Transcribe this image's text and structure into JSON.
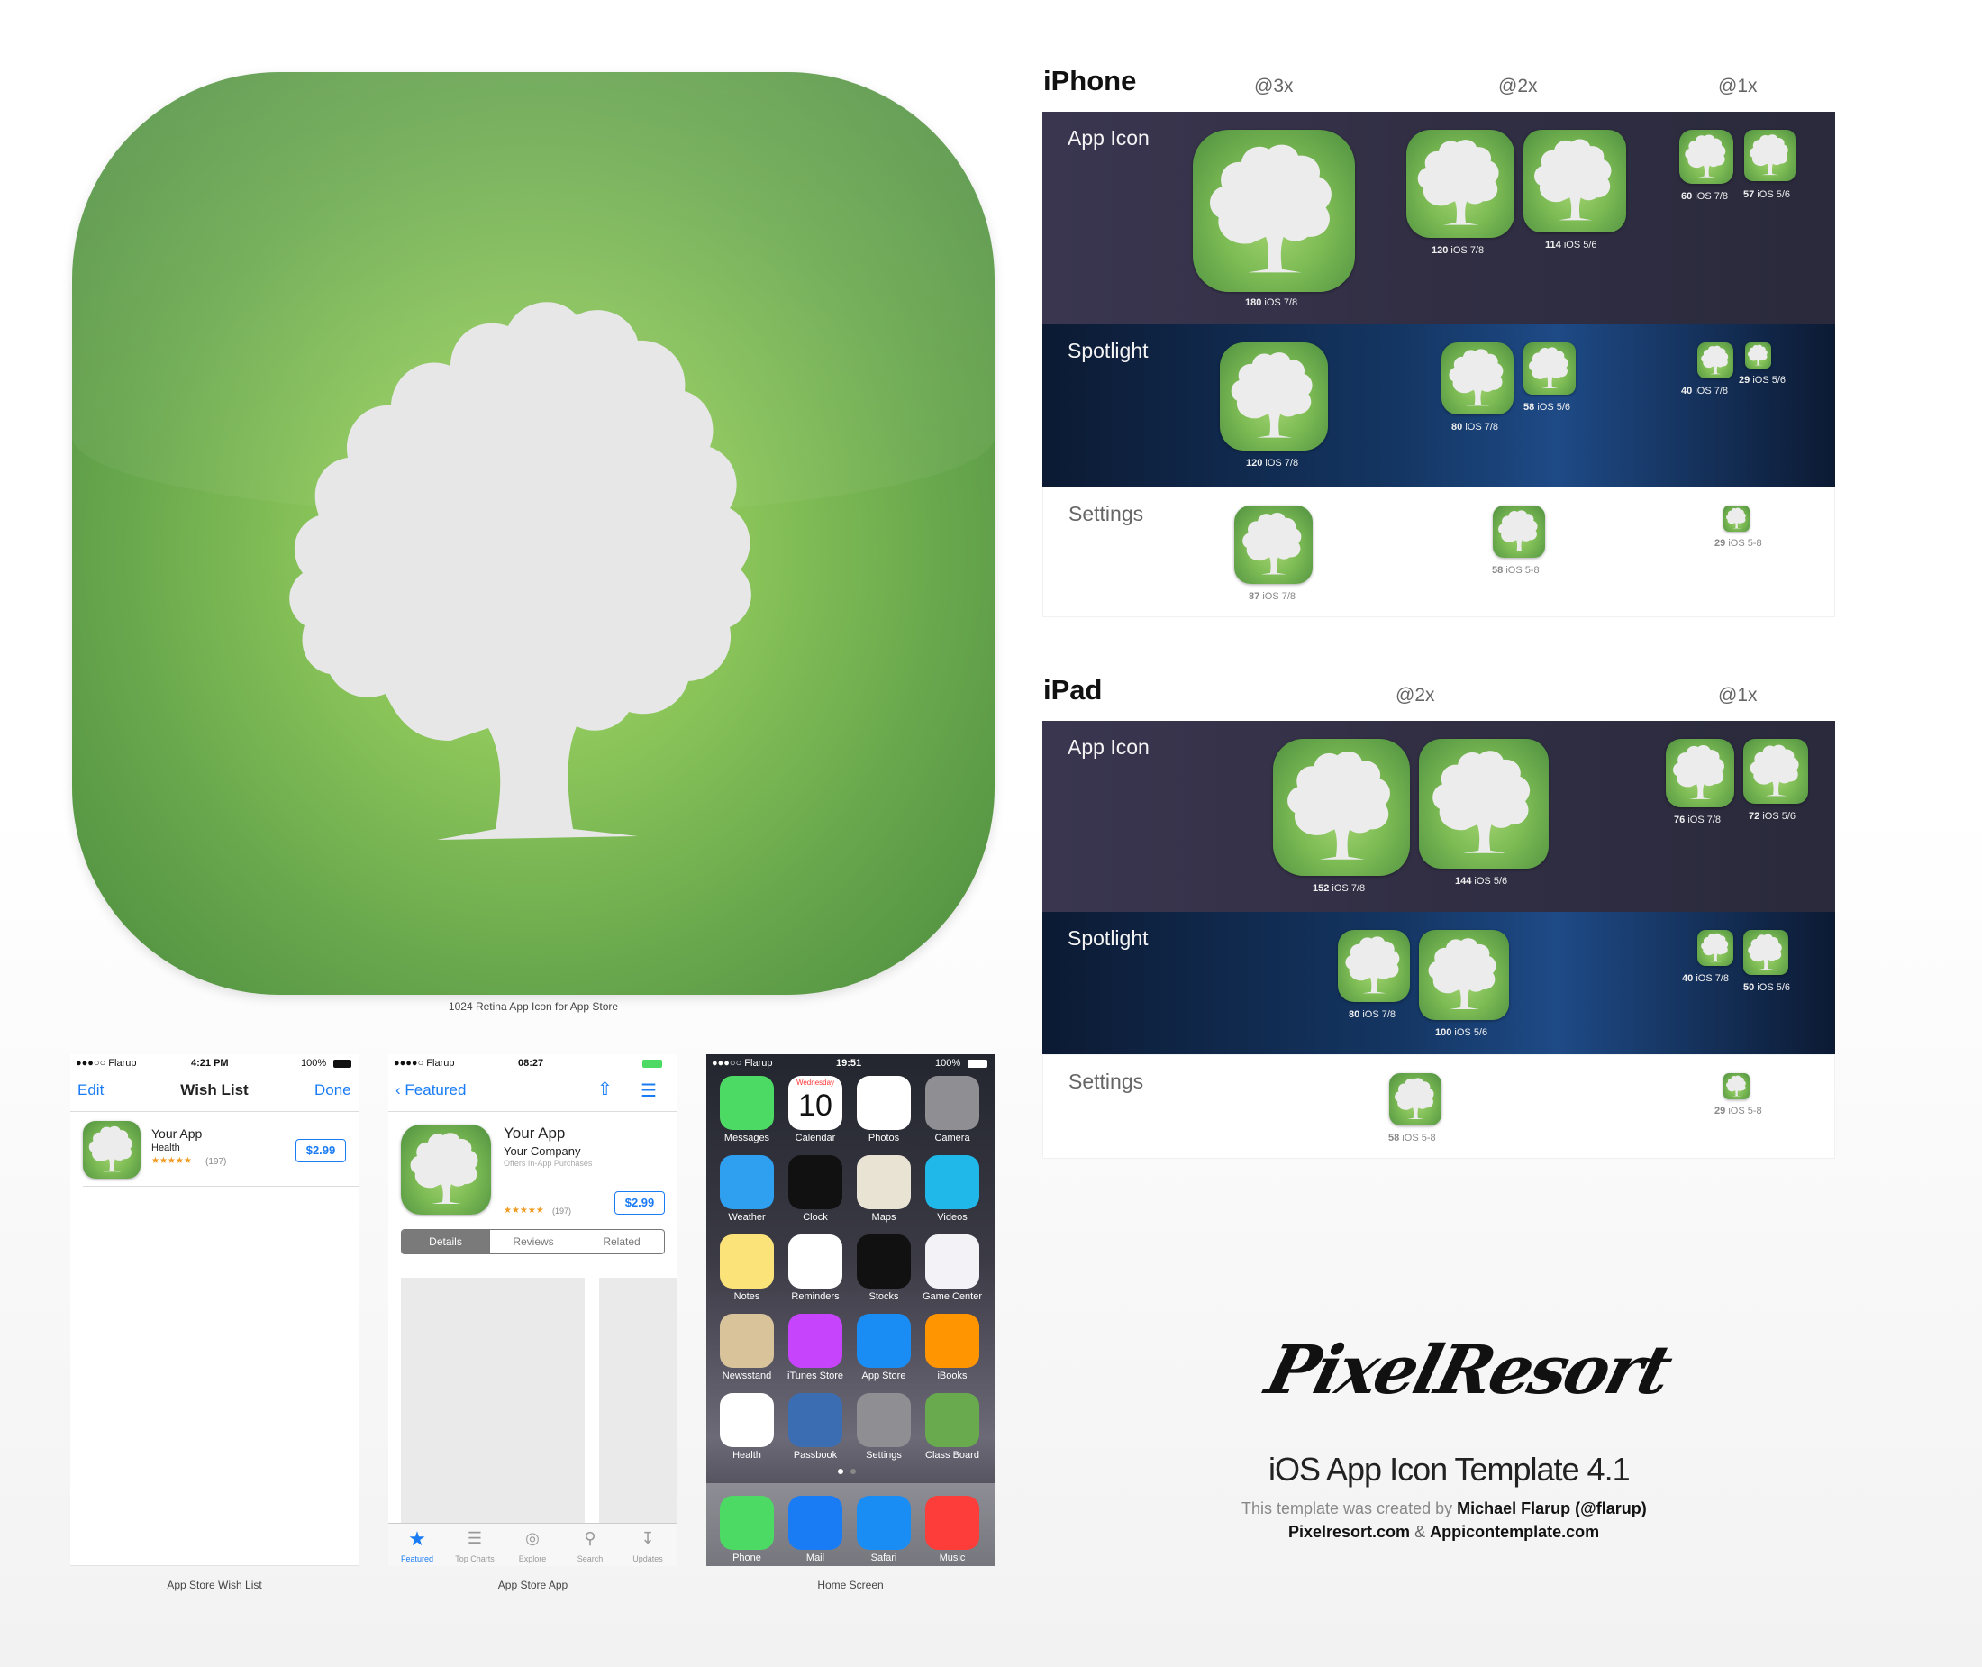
{
  "big_icon": {
    "caption": "1024 Retina App Icon for App Store"
  },
  "iphone": {
    "title": "iPhone",
    "scales": [
      "@3x",
      "@2x",
      "@1x"
    ],
    "rows": {
      "app_icon": "App Icon",
      "spotlight": "Spotlight",
      "settings": "Settings"
    },
    "labels": [
      {
        "size": "180",
        "os": "iOS 7/8"
      },
      {
        "size": "120",
        "os": "iOS 7/8"
      },
      {
        "size": "114",
        "os": "iOS 5/6"
      },
      {
        "size": "60",
        "os": "iOS 7/8"
      },
      {
        "size": "57",
        "os": "iOS 5/6"
      },
      {
        "size": "120",
        "os": "iOS 7/8"
      },
      {
        "size": "80",
        "os": "iOS 7/8"
      },
      {
        "size": "58",
        "os": "iOS 5/6"
      },
      {
        "size": "40",
        "os": "iOS 7/8"
      },
      {
        "size": "29",
        "os": "iOS 5/6"
      },
      {
        "size": "87",
        "os": "iOS 7/8"
      },
      {
        "size": "58",
        "os": "iOS 5-8"
      },
      {
        "size": "29",
        "os": "iOS 5-8"
      }
    ]
  },
  "ipad": {
    "title": "iPad",
    "scales": [
      "@2x",
      "@1x"
    ],
    "rows": {
      "app_icon": "App Icon",
      "spotlight": "Spotlight",
      "settings": "Settings"
    },
    "labels": [
      {
        "size": "152",
        "os": "iOS 7/8"
      },
      {
        "size": "144",
        "os": "iOS 5/6"
      },
      {
        "size": "76",
        "os": "iOS 7/8"
      },
      {
        "size": "72",
        "os": "iOS 5/6"
      },
      {
        "size": "80",
        "os": "iOS 7/8"
      },
      {
        "size": "100",
        "os": "iOS 5/6"
      },
      {
        "size": "40",
        "os": "iOS 7/8"
      },
      {
        "size": "50",
        "os": "iOS 5/6"
      },
      {
        "size": "58",
        "os": "iOS 5-8"
      },
      {
        "size": "29",
        "os": "iOS 5-8"
      }
    ]
  },
  "wishlist": {
    "status": {
      "carrier": "●●●○○ Flarup",
      "time": "4:21 PM",
      "battery": "100%"
    },
    "edit": "Edit",
    "title": "Wish List",
    "done": "Done",
    "item": {
      "name": "Your App",
      "category": "Health",
      "stars": "★★★★★",
      "reviews": "(197)",
      "price": "$2.99"
    },
    "caption": "App Store Wish List"
  },
  "appstore": {
    "status": {
      "carrier": "●●●●○ Flarup",
      "time": "08:27"
    },
    "back": "Featured",
    "app": {
      "name": "Your App",
      "company": "Your Company",
      "iap": "Offers In-App Purchases",
      "stars": "★★★★★",
      "reviews": "(197)",
      "price": "$2.99"
    },
    "segments": [
      "Details",
      "Reviews",
      "Related"
    ],
    "tabs": [
      "Featured",
      "Top Charts",
      "Explore",
      "Search",
      "Updates"
    ],
    "caption": "App Store App"
  },
  "homescreen": {
    "status": {
      "carrier": "●●●○○ Flarup",
      "time": "19:51",
      "battery": "100%"
    },
    "calendar": {
      "day": "Wednesday",
      "date": "10"
    },
    "apps": [
      "Messages",
      "Calendar",
      "Photos",
      "Camera",
      "Weather",
      "Clock",
      "Maps",
      "Videos",
      "Notes",
      "Reminders",
      "Stocks",
      "Game Center",
      "Newsstand",
      "iTunes Store",
      "App Store",
      "iBooks",
      "Health",
      "Passbook",
      "Settings",
      "Class Board"
    ],
    "app_colors": [
      "#4cd964",
      "#ffffff",
      "#ffffff",
      "#8e8e93",
      "#2f9ff0",
      "#111111",
      "#e9e3d4",
      "#1fb8e8",
      "#fbe37a",
      "#ffffff",
      "#111111",
      "#f2f2f7",
      "#d8c39a",
      "#c644fc",
      "#1a8df5",
      "#ff9500",
      "#ffffff",
      "#3b6db3",
      "#8e8e93",
      "#6aaa4e"
    ],
    "dock": [
      "Phone",
      "Mail",
      "Safari",
      "Music"
    ],
    "dock_colors": [
      "#4cd964",
      "#1a7cf5",
      "#1a8df5",
      "#fc3d39"
    ],
    "caption": "Home Screen"
  },
  "credits": {
    "logo": "PixelResort",
    "title": "iOS App Icon Template 4.1",
    "created_prefix": "This template was created by",
    "author": "Michael Flarup (@flarup)",
    "site1": "Pixelresort.com",
    "amp": "&",
    "site2": "Appicontemplate.com"
  }
}
